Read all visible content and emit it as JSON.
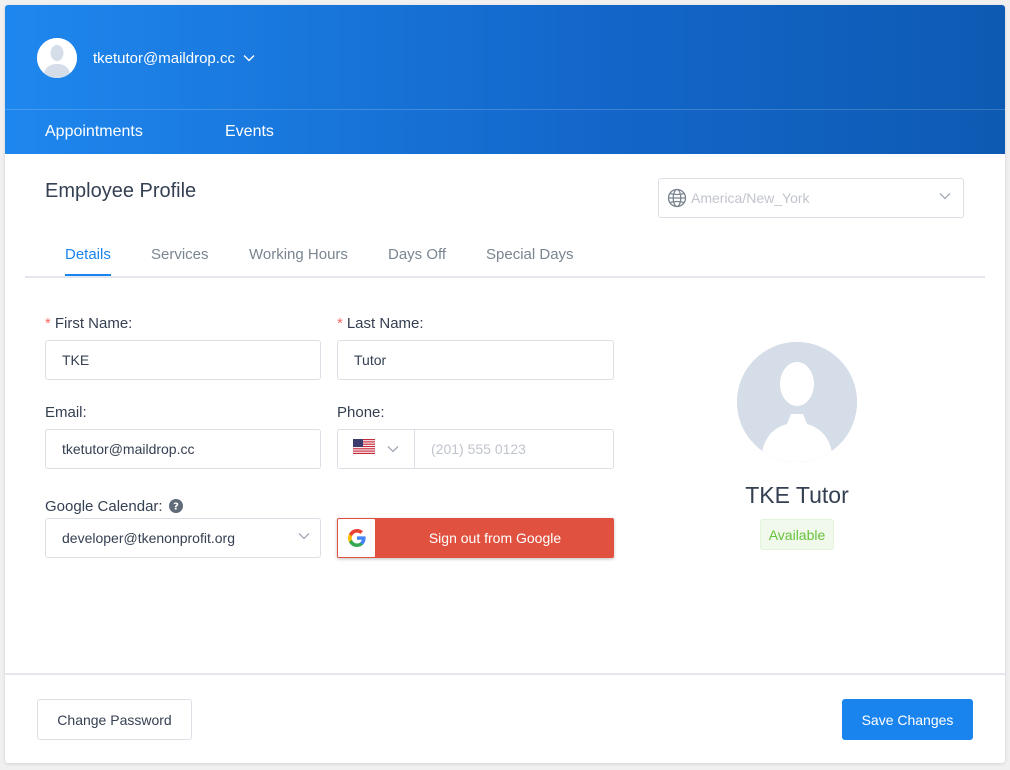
{
  "header": {
    "user_email": "tketutor@maildrop.cc",
    "nav": [
      {
        "label": "Appointments"
      },
      {
        "label": "Events"
      }
    ]
  },
  "page": {
    "title": "Employee Profile",
    "timezone_placeholder": "America/New_York"
  },
  "tabs": [
    {
      "label": "Details",
      "active": true
    },
    {
      "label": "Services",
      "active": false
    },
    {
      "label": "Working Hours",
      "active": false
    },
    {
      "label": "Days Off",
      "active": false
    },
    {
      "label": "Special Days",
      "active": false
    }
  ],
  "form": {
    "required_mark": "*",
    "first_name_label": "First Name:",
    "first_name_value": "TKE",
    "last_name_label": "Last Name:",
    "last_name_value": "Tutor",
    "email_label": "Email:",
    "email_value": "tketutor@maildrop.cc",
    "phone_label": "Phone:",
    "phone_placeholder": "(201) 555 0123",
    "google_calendar_label": "Google Calendar:",
    "google_calendar_value": "developer@tkenonprofit.org",
    "google_button_label": "Sign out from Google"
  },
  "profile": {
    "name": "TKE Tutor",
    "status": "Available"
  },
  "footer": {
    "change_password_label": "Change Password",
    "save_label": "Save Changes"
  },
  "colors": {
    "primary": "#1a84ee",
    "header_start": "#1e87ee",
    "header_end": "#0d5ab3",
    "google_red": "#e0523f",
    "available_green": "#67c23a",
    "required_red": "#f56c6c"
  },
  "icons": {
    "user_avatar": "user-avatar-icon",
    "caret": "chevron-down-icon",
    "globe": "globe-icon",
    "help": "question-circle-icon",
    "flag": "us-flag-icon",
    "google": "google-g-icon"
  }
}
